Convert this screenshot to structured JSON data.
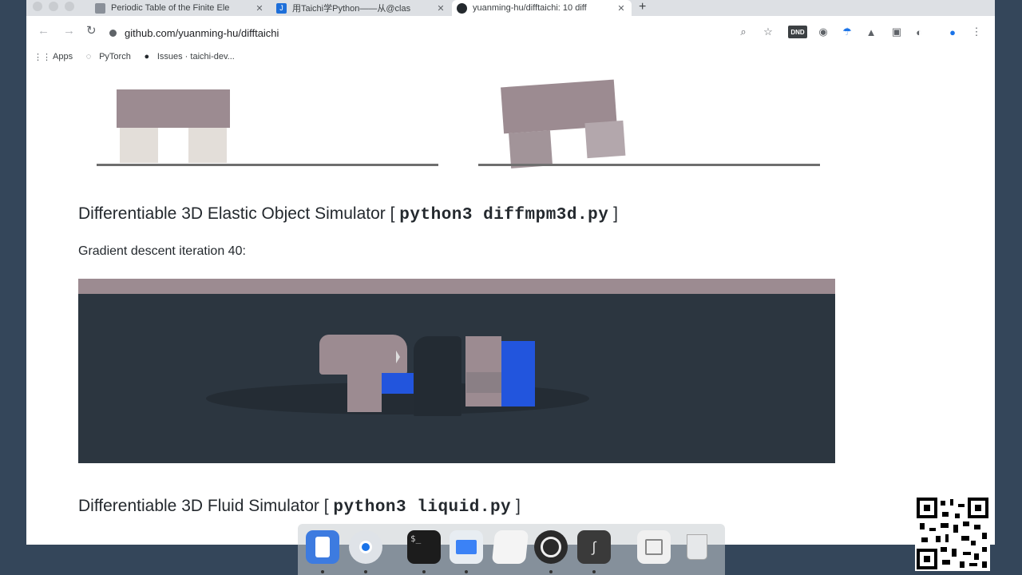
{
  "tabs": [
    {
      "title": "Periodic Table of the Finite Ele",
      "favicon": "document-icon",
      "active": false
    },
    {
      "title": "用Taichi学Python——从@clas",
      "favicon": "taichi-icon",
      "active": false
    },
    {
      "title": "yuanming-hu/difftaichi: 10 diff",
      "favicon": "github-icon",
      "active": true
    }
  ],
  "toolbar": {
    "url": "github.com/yuanming-hu/difftaichi",
    "dnd_badge": "DND"
  },
  "bookmarks": [
    {
      "label": "Apps",
      "icon": "apps-grid-icon"
    },
    {
      "label": "PyTorch",
      "icon": "pytorch-icon"
    },
    {
      "label": "Issues · taichi-dev...",
      "icon": "github-icon"
    }
  ],
  "page": {
    "section1": {
      "title": "Differentiable 3D Elastic Object Simulator [ ",
      "code": "python3 diffmpm3d.py",
      "close": " ]"
    },
    "iteration_text": "Gradient descent iteration 40:",
    "section2": {
      "title": "Differentiable 3D Fluid Simulator [ ",
      "code": "python3 liquid.py",
      "close": " ]"
    }
  },
  "dock_apps": [
    "finder-icon",
    "chrome-icon",
    "terminal-icon",
    "keynote-icon",
    "preview-icon",
    "obs-icon",
    "grapher-icon",
    "files-icon",
    "trash-icon"
  ],
  "colors": {
    "page_text": "#24292e",
    "sim_background": "#2c3640",
    "object_mauve": "#9c8b91",
    "object_blue": "#2255dd"
  }
}
